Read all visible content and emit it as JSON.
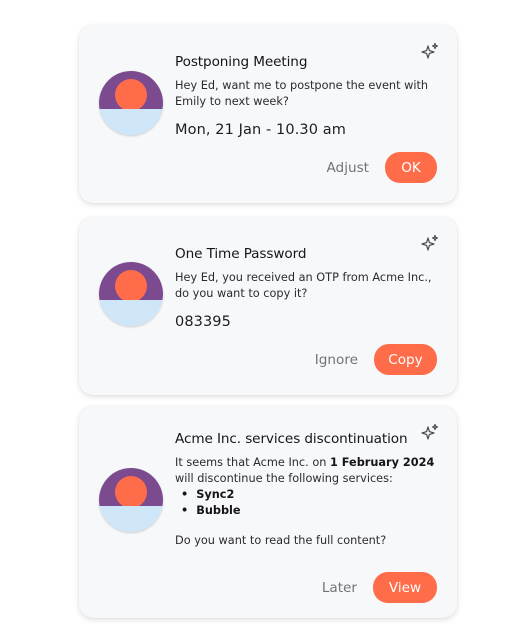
{
  "colors": {
    "accent": "#ff6c4a",
    "avatar_top": "#7c4b8f",
    "avatar_sun": "#ff6c4a",
    "avatar_bottom": "#cfe6f8",
    "card_bg": "#f7f8fa"
  },
  "cards": [
    {
      "icon": "sparkles-icon",
      "avatar": "sunset-avatar",
      "title": "Postponing Meeting",
      "message": "Hey Ed, want me to postpone the event with Emily to next week?",
      "detail": "Mon, 21 Jan - 10.30 am",
      "secondary_label": "Adjust",
      "primary_label": "OK"
    },
    {
      "icon": "sparkles-icon",
      "avatar": "sunset-avatar",
      "title": "One Time Password",
      "message": "Hey Ed, you received an OTP from Acme Inc., do you want to copy it?",
      "detail": "083395",
      "secondary_label": "Ignore",
      "primary_label": "Copy"
    },
    {
      "icon": "sparkles-icon",
      "avatar": "sunset-avatar",
      "title": "Acme Inc. services discontinuation",
      "message_parts": {
        "pre": "It seems that Acme Inc. on ",
        "date": "1 February 2024",
        "post": " will discontinue the following services:"
      },
      "services": [
        "Sync2",
        "Bubble"
      ],
      "question": "Do you want to read the full content?",
      "secondary_label": "Later",
      "primary_label": "View"
    }
  ]
}
